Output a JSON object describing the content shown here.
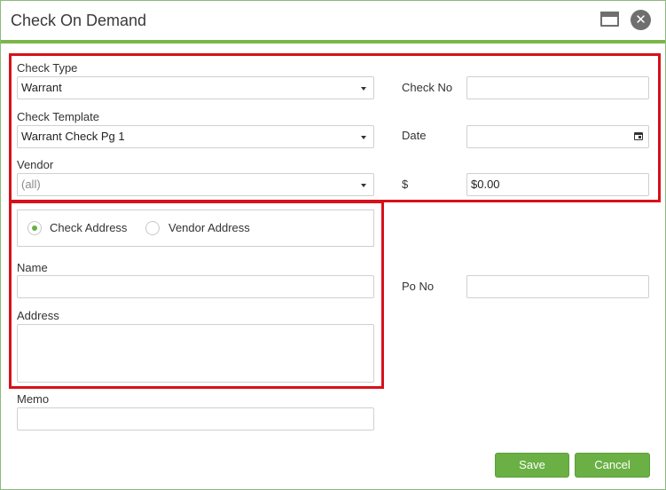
{
  "window": {
    "title": "Check On Demand"
  },
  "labels": {
    "check_type": "Check Type",
    "check_template": "Check Template",
    "vendor": "Vendor",
    "check_no": "Check No",
    "date": "Date",
    "amount": "$",
    "name": "Name",
    "address": "Address",
    "po_no": "Po No",
    "memo": "Memo"
  },
  "fields": {
    "check_type": "Warrant",
    "check_template": "Warrant Check Pg 1",
    "vendor_placeholder": "(all)",
    "check_no": "",
    "date": "",
    "amount": "$0.00",
    "name": "",
    "address": "",
    "po_no": "",
    "memo": ""
  },
  "address_options": [
    {
      "label": "Check Address",
      "selected": true
    },
    {
      "label": "Vendor Address",
      "selected": false
    }
  ],
  "buttons": {
    "save": "Save",
    "cancel": "Cancel"
  },
  "colors": {
    "accent": "#6ab045",
    "highlight": "#d6111a"
  },
  "icons": {
    "maximize": "window-maximize-icon",
    "close": "close-icon",
    "dropdown": "chevron-down-icon",
    "calendar": "calendar-icon"
  }
}
